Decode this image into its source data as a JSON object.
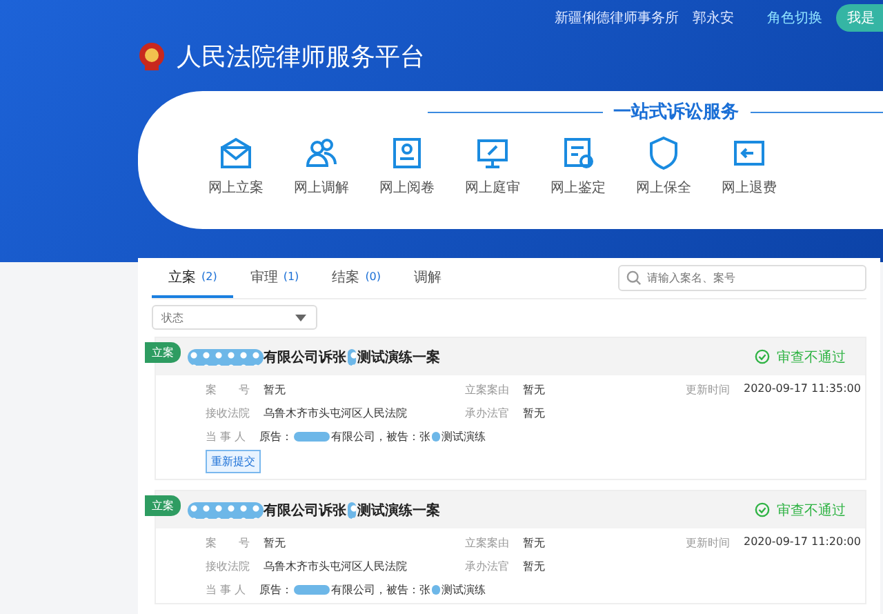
{
  "header": {
    "firm": "新疆俐德律师事务所",
    "user": "郭永安",
    "role_switch": "角色切换",
    "role_button": "我是",
    "title": "人民法院律师服务平台"
  },
  "services": {
    "slogan": "一站式诉讼服务",
    "items": [
      {
        "kind": "envelope",
        "label": "网上立案"
      },
      {
        "kind": "people",
        "label": "网上调解"
      },
      {
        "kind": "document",
        "label": "网上阅卷"
      },
      {
        "kind": "hearing",
        "label": "网上庭审"
      },
      {
        "kind": "appraisal",
        "label": "网上鉴定"
      },
      {
        "kind": "shield",
        "label": "网上保全"
      },
      {
        "kind": "refund",
        "label": "网上退费"
      }
    ]
  },
  "tabs": [
    {
      "label": "立案",
      "count": "(2)",
      "selected": true
    },
    {
      "label": "审理",
      "count": "(1)",
      "selected": false
    },
    {
      "label": "结案",
      "count": "(0)",
      "selected": false
    },
    {
      "label": "调解",
      "selected": false
    }
  ],
  "search": {
    "placeholder": "请输入案名、案号"
  },
  "status_filter": {
    "placeholder": "状态"
  },
  "cases": [
    {
      "tag": "立案",
      "title_a": "有限公司诉张",
      "title_b": "测试演练一案",
      "status": "审查不通过",
      "fields": [
        {
          "label": "案　　号",
          "value": "暂无"
        },
        {
          "label": "立案案由",
          "value": "暂无"
        },
        {
          "label": "更新时间",
          "value": "2020-09-17 11:35:00"
        },
        {
          "label": "接收法院",
          "value": "乌鲁木齐市头屯河区人民法院"
        },
        {
          "label": "承办法官",
          "value": "暂无"
        }
      ],
      "party_label": "当 事 人",
      "party_a": "原告：",
      "party_b": "有限公司，被告：张",
      "party_c": "测试演练",
      "button": "重新提交"
    },
    {
      "tag": "立案",
      "title_a": "有限公司诉张",
      "title_b": "测试演练一案",
      "status": "审查不通过",
      "fields": [
        {
          "label": "案　　号",
          "value": "暂无"
        },
        {
          "label": "立案案由",
          "value": "暂无"
        },
        {
          "label": "更新时间",
          "value": "2020-09-17 11:20:00"
        },
        {
          "label": "接收法院",
          "value": "乌鲁木齐市头屯河区人民法院"
        },
        {
          "label": "承办法官",
          "value": "暂无"
        }
      ],
      "party_label": "当 事 人",
      "party_a": "原告：",
      "party_b": "有限公司，被告：张",
      "party_c": "测试演练"
    }
  ]
}
